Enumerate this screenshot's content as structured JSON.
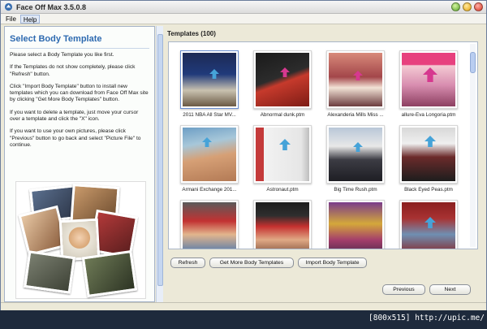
{
  "window": {
    "title": "Face Off Max  3.5.0.8"
  },
  "menu": {
    "items": [
      {
        "label": "File"
      },
      {
        "label": "Help"
      }
    ]
  },
  "left": {
    "heading": "Select Body Template",
    "p1": "Please select a Body Template you like first.",
    "p2": "If the Templates do not show completely, please click \"Refresh\" button.",
    "p3": "Click \"Import Body Template\" button to install new templates which you can download from Face Off Max site by clicking \"Get More Body Templates\" button.",
    "p4": "If you want to delete a template, just move your cursor over a template and click the \"X\" icon.",
    "p5": "If you want to use your own pictures, please click \"Previous\" button to go back and select \"Picture File\" to continue."
  },
  "templates": {
    "header": "Templates (100)",
    "items": [
      {
        "label": "2011 NBA All Star MV..."
      },
      {
        "label": "Abnormal dunk.ptm"
      },
      {
        "label": "Alexanderia Mills Miss ..."
      },
      {
        "label": "allure-Eva Longoria.ptm"
      },
      {
        "label": "Armani Exchange 201..."
      },
      {
        "label": "Astronaut.ptm"
      },
      {
        "label": "Big Time Rush.ptm"
      },
      {
        "label": "Black Eyed Peas.ptm"
      },
      {
        "label": ""
      },
      {
        "label": ""
      },
      {
        "label": ""
      },
      {
        "label": ""
      }
    ]
  },
  "buttons": {
    "refresh": "Refresh",
    "get_more": "Get More Body Templates",
    "import": "Import Body Template",
    "previous": "Previous",
    "next": "Next"
  },
  "footer": {
    "tag": "[800x515] http://upic.me/"
  },
  "colors": {
    "accent": "#2e6ab0",
    "panel_border": "#a9b6c8",
    "face_marker": "#d6388f"
  }
}
